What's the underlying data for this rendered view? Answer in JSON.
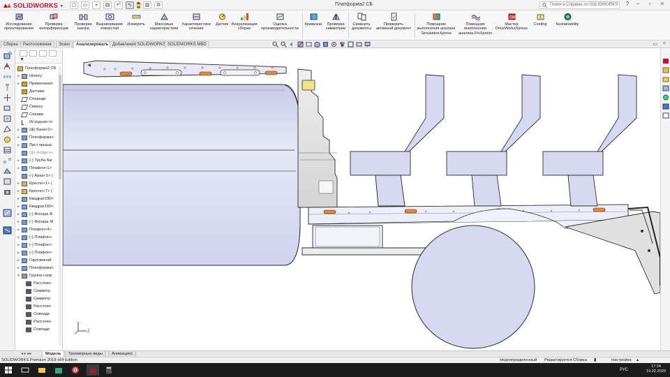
{
  "app": {
    "brand": "SOLIDWORKS",
    "document_title": "Платформа2 СБ",
    "search_placeholder": "Поиск в Справке по SOLIDWORKS"
  },
  "ribbon": {
    "buttons": [
      {
        "id": "design-study",
        "label1": "Исследование",
        "label2": "проектирования"
      },
      {
        "id": "interference",
        "label1": "Проверка",
        "label2": "интерференции"
      },
      {
        "id": "clearance",
        "label1": "Проверка",
        "label2": "зазора"
      },
      {
        "id": "hole-align",
        "label1": "Выравнивание",
        "label2": "отверстий"
      },
      {
        "id": "measure",
        "label1": "Измерить",
        "label2": ""
      },
      {
        "id": "mass-props",
        "label1": "Массовые",
        "label2": "характеристики"
      },
      {
        "id": "section-props",
        "label1": "Характеристики",
        "label2": "сечения"
      },
      {
        "id": "sensor",
        "label1": "Датчик",
        "label2": ""
      },
      {
        "id": "assembly-viz",
        "label1": "Визуализация",
        "label2": "сборки"
      },
      {
        "id": "perf-eval",
        "label1": "Оценка",
        "label2": "производительности"
      },
      {
        "id": "curvature",
        "label1": "Кривизна",
        "label2": ""
      },
      {
        "id": "symmetry",
        "label1": "Проверка",
        "label2": "симметрии"
      },
      {
        "id": "compare",
        "label1": "Сравнить",
        "label2": "документы"
      },
      {
        "id": "check-active",
        "label1": "Проверить",
        "label2": "активный документ"
      },
      {
        "id": "simxpress",
        "label1": "Помощник",
        "label2": "выполнения анализа",
        "label3": "SimulationXpress"
      },
      {
        "id": "floxpress",
        "label1": "Помощник",
        "label2": "выполнения",
        "label3": "анализа FloXpress"
      },
      {
        "id": "driveworks",
        "label1": "Мастер",
        "label2": "DriveWorksXpress"
      },
      {
        "id": "costing",
        "label1": "Costing",
        "label2": ""
      },
      {
        "id": "sustainability",
        "label1": "Sustainability",
        "label2": ""
      }
    ]
  },
  "tabs": [
    "Сборка",
    "Расположение",
    "Эскиз",
    "Анализировать",
    "Добавления SOLIDWORKS",
    "SOLIDWORKS MBD"
  ],
  "active_tab": "Анализировать",
  "tree": {
    "root": "Платформа2 СБ",
    "items": [
      {
        "label": "History",
        "icon": "history-icon",
        "indent": 1,
        "expand": "▸"
      },
      {
        "label": "Примечания",
        "icon": "annotation-icon",
        "indent": 1,
        "expand": "▸"
      },
      {
        "label": "Датчики",
        "icon": "sensor-icon",
        "indent": 1,
        "expand": ""
      },
      {
        "label": "Спереди",
        "icon": "plane-icon",
        "indent": 1,
        "expand": ""
      },
      {
        "label": "Сверху",
        "icon": "plane-icon",
        "indent": 1,
        "expand": ""
      },
      {
        "label": "Справа",
        "icon": "plane-icon",
        "indent": 1,
        "expand": ""
      },
      {
        "label": "Исходная то",
        "icon": "origin-icon",
        "indent": 1,
        "expand": ""
      },
      {
        "label": "(ф) База<2>",
        "icon": "part-icon",
        "indent": 1,
        "expand": "▸"
      },
      {
        "label": "Платформа<",
        "icon": "part-icon",
        "indent": 1,
        "expand": "▸"
      },
      {
        "label": "Лист крыша",
        "icon": "part-icon",
        "indent": 1,
        "expand": "▸"
      },
      {
        "label": "(ф) dodge ra",
        "icon": "part-icon",
        "indent": 1,
        "expand": "",
        "dim": true
      },
      {
        "label": "(-) Труба баг",
        "icon": "part-icon",
        "indent": 1,
        "expand": "▸"
      },
      {
        "label": "Плафон<1>",
        "icon": "part-icon",
        "indent": 1,
        "expand": "▸"
      },
      {
        "label": "(-) Арка<1> (",
        "icon": "part-icon",
        "indent": 1,
        "expand": ""
      },
      {
        "label": "Кресло<1> (",
        "icon": "assembly-icon",
        "indent": 1,
        "expand": "▸"
      },
      {
        "label": "Кресло<7> (",
        "icon": "assembly-icon",
        "indent": 1,
        "expand": "▸"
      },
      {
        "label": "Квадрат230<",
        "icon": "part-icon",
        "indent": 1,
        "expand": "▸"
      },
      {
        "label": "Квадрат160<",
        "icon": "part-icon",
        "indent": 1,
        "expand": "▸"
      },
      {
        "label": "(-) Фонарь В",
        "icon": "part-icon",
        "indent": 1,
        "expand": "▸"
      },
      {
        "label": "(-) Фонарь М",
        "icon": "part-icon",
        "indent": 1,
        "expand": "▸"
      },
      {
        "label": "Плафон<4>",
        "icon": "part-icon",
        "indent": 1,
        "expand": "▸"
      },
      {
        "label": "(-) Плафон<",
        "icon": "part-icon",
        "indent": 1,
        "expand": "▸"
      },
      {
        "label": "(-) Плафон<",
        "icon": "part-icon",
        "indent": 1,
        "expand": "▸"
      },
      {
        "label": "(-) Плафон<",
        "icon": "part-icon",
        "indent": 1,
        "expand": "▸"
      },
      {
        "label": "ГорловинаК",
        "icon": "part-icon",
        "indent": 1,
        "expand": "▸"
      },
      {
        "label": "Платформа<",
        "icon": "part-icon",
        "indent": 1,
        "expand": "▸"
      },
      {
        "label": "Группа сопр",
        "icon": "mates-icon",
        "indent": 1,
        "expand": "▾"
      },
      {
        "label": "Расстоян",
        "icon": "mate-distance-icon",
        "indent": 2,
        "expand": ""
      },
      {
        "label": "Симметр",
        "icon": "mate-symmetric-icon",
        "indent": 2,
        "expand": ""
      },
      {
        "label": "Симметр",
        "icon": "mate-symmetric-icon",
        "indent": 2,
        "expand": ""
      },
      {
        "label": "Расстоян",
        "icon": "mate-distance-icon",
        "indent": 2,
        "expand": ""
      },
      {
        "label": "Совпаде",
        "icon": "mate-coincident-icon",
        "indent": 2,
        "expand": ""
      },
      {
        "label": "Расстоян",
        "icon": "mate-distance-icon",
        "indent": 2,
        "expand": ""
      },
      {
        "label": "Совпаде",
        "icon": "mate-coincident-icon",
        "indent": 2,
        "expand": ""
      }
    ]
  },
  "bottom_tabs": [
    "Модель",
    "Трехмерные виды",
    "Анимация1"
  ],
  "active_bottom_tab": "Модель",
  "status": {
    "edition": "SOLIDWORKS Premium 2018 x64 Edition",
    "definition": "Недоопределенный",
    "editing": "Редактируется Сборка",
    "settings": "Настройка"
  },
  "taskbar": {
    "lang": "РУС",
    "time": "17:34",
    "date": "19.02.2020"
  },
  "colors": {
    "accent_red": "#c8102e",
    "model_blue": "#d6d9f1",
    "model_outline": "#2b2b2b",
    "lamp_orange": "#e9863a"
  }
}
